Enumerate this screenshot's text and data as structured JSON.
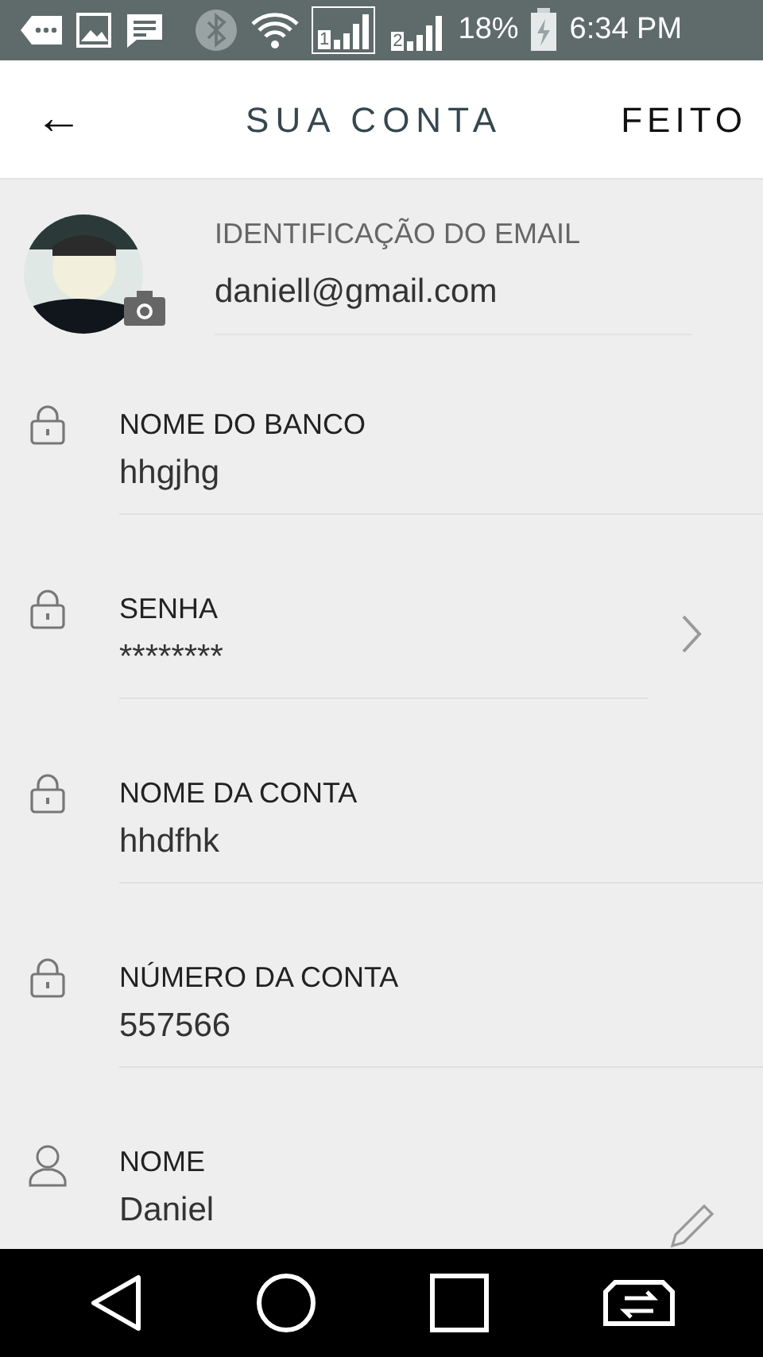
{
  "status_bar": {
    "sim_1": "1",
    "sim_2": "2",
    "battery": "18%",
    "time": "6:34 PM"
  },
  "header": {
    "back": "←",
    "title": "SUA CONTA",
    "done": "FEITO"
  },
  "profile": {
    "label": "IDENTIFICAÇÃO DO EMAIL",
    "value": "daniell@gmail.com"
  },
  "fields": [
    {
      "kind": "locked",
      "label": "NOME DO BANCO",
      "value": "hhgjhg"
    },
    {
      "kind": "locked-link",
      "label": "SENHA",
      "value": "********"
    },
    {
      "kind": "locked",
      "label": "NOME DA CONTA",
      "value": "hhdfhk"
    },
    {
      "kind": "locked",
      "label": "NÚMERO DA CONTA",
      "value": "557566"
    },
    {
      "kind": "editable",
      "label": "NOME",
      "value": "Daniel"
    }
  ]
}
